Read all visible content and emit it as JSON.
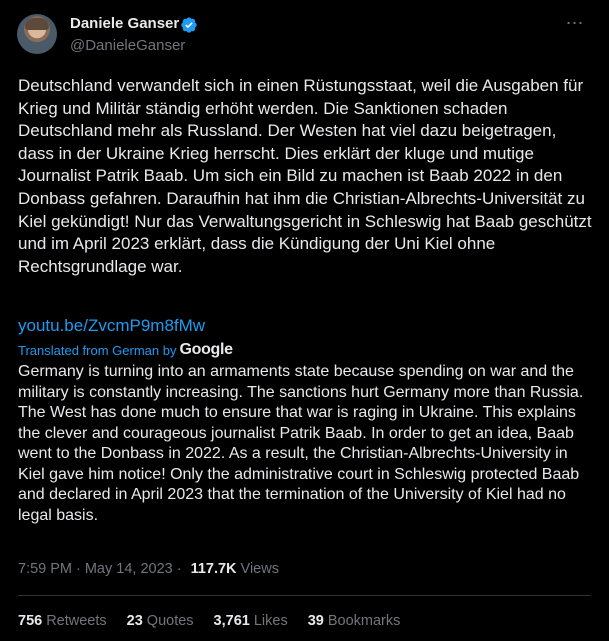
{
  "author": {
    "name": "Daniele Ganser",
    "handle": "@DanieleGanser"
  },
  "more_icon": "⋯",
  "tweet": {
    "text_de": "Deutschland verwandelt sich in einen Rüstungsstaat, weil die Ausgaben für Krieg und Militär ständig erhöht werden. Die Sanktionen schaden Deutschland mehr als Russland. Der Westen hat viel dazu beigetragen, dass in der Ukraine Krieg herrscht. Dies erklärt der kluge und mutige Journalist Patrik Baab. Um sich ein Bild zu machen ist Baab 2022 in den Donbass gefahren. Daraufhin hat ihm die Christian-Albrechts-Universität zu Kiel gekündigt! Nur das Verwaltungsgericht in Schleswig hat Baab geschützt und im April 2023 erklärt, dass die Kündigung der Uni Kiel ohne Rechtsgrundlage war.",
    "link": "youtu.be/ZvcmP9m8fMw",
    "translated_label": "Translated from German by",
    "translator": "Google",
    "text_en": "Germany is turning into an armaments state because spending on war and the military is constantly increasing. The sanctions hurt Germany more than Russia. The West has done much to ensure that war is raging in Ukraine. This explains the clever and courageous journalist Patrik Baab. In order to get an idea, Baab went to the Donbass in 2022. As a result, the Christian-Albrechts-University in Kiel gave him notice! Only the administrative court in Schleswig protected Baab and declared in April 2023 that the termination of the University of Kiel had no legal basis."
  },
  "meta": {
    "time": "7:59 PM",
    "separator": "·",
    "date": "May 14, 2023",
    "views_count": "117.7K",
    "views_label": "Views"
  },
  "stats": [
    {
      "count": "756",
      "label": "Retweets"
    },
    {
      "count": "23",
      "label": "Quotes"
    },
    {
      "count": "3,761",
      "label": "Likes"
    },
    {
      "count": "39",
      "label": "Bookmarks"
    }
  ],
  "colors": {
    "background": "#000000",
    "text": "#e7e9ea",
    "muted": "#71767b",
    "accent": "#1d9bf0",
    "divider": "#2f3336"
  }
}
